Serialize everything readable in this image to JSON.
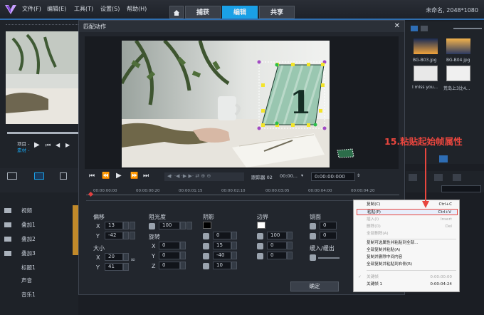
{
  "app": {
    "menu": [
      "文件(F)",
      "编辑(E)",
      "工具(T)",
      "设置(S)",
      "帮助(H)"
    ],
    "tabs": [
      "捕获",
      "编辑",
      "共享"
    ],
    "active_tab": "编辑",
    "project_name": "未命名, 2048*1080"
  },
  "left_panel": {
    "labels": [
      "项目 -",
      "素材 -"
    ]
  },
  "library": {
    "items": [
      {
        "name": "BG-B03.jpg"
      },
      {
        "name": "BG-B04.jpg"
      },
      {
        "name": "I miss you..."
      },
      {
        "name": "荒岛上3比4..."
      }
    ]
  },
  "dialog": {
    "title": "匹配动作",
    "close": "✕",
    "overlay_number": "1",
    "tracker": {
      "label": "跟踪器 02",
      "time_prefix": "00:00...",
      "timecode": "0:00:00:000"
    },
    "ruler_ticks": [
      "00:00:00:00",
      "00:00:00:20",
      "00:00:01:15",
      "00:00:02:10",
      "00:00:03:05",
      "00:00:04:00",
      "00:00:04:20"
    ],
    "offset": {
      "label": "偏移",
      "x_label": "X",
      "x": "13",
      "y_label": "Y",
      "y": "-42"
    },
    "size": {
      "label": "大小",
      "x_label": "X",
      "x": "20",
      "y_label": "Y",
      "y": "41"
    },
    "opacity": {
      "label": "阻光度",
      "value": "100"
    },
    "rotation": {
      "label": "旋转",
      "x_label": "X",
      "x": "0",
      "y_label": "Y",
      "y": "0",
      "z_label": "Z",
      "z": "0"
    },
    "shadow": {
      "label": "阴影",
      "v1": "0",
      "v2": "15",
      "v3": "-40",
      "v4": "10"
    },
    "border": {
      "label": "边界",
      "v1": "100",
      "v2": "0",
      "v3": "0"
    },
    "mirror": {
      "label": "镜面",
      "v1": "0",
      "v2": "0"
    },
    "fade": {
      "label": "缓入/缓出"
    },
    "ok_button": "确定"
  },
  "tracks": {
    "items": [
      "视频",
      "叠加1",
      "叠加2",
      "叠加3",
      "标题1",
      "声音",
      "音乐1"
    ]
  },
  "context_menu": {
    "items": [
      {
        "label": "复制(C)",
        "shortcut": "Ctrl+C",
        "disabled": false
      },
      {
        "label": "粘贴(P)",
        "shortcut": "Ctrl+V",
        "disabled": false,
        "highlighted": true
      },
      {
        "label": "插入(I)",
        "shortcut": "Insert",
        "disabled": true
      },
      {
        "label": "删除(D)",
        "shortcut": "Del",
        "disabled": true
      },
      {
        "label": "全部删除(A)",
        "shortcut": "",
        "disabled": true
      },
      {
        "label": "复制可选属性并粘贴到全部...",
        "shortcut": "",
        "disabled": false
      },
      {
        "label": "全部复制并粘贴(A)",
        "shortcut": "",
        "disabled": false
      },
      {
        "label": "复制并删除中间内容",
        "shortcut": "",
        "disabled": false
      },
      {
        "label": "全部复制并粘贴到右侧(R)",
        "shortcut": "",
        "disabled": false
      }
    ],
    "keyframes": [
      {
        "check": "✓",
        "label": "关键帧",
        "time": "0:00:00:00",
        "disabled": true
      },
      {
        "check": "",
        "label": "关键帧  1",
        "time": "0:00:04:24",
        "disabled": false
      }
    ]
  },
  "annotation": "15.粘贴起始帧属性",
  "colors": {
    "accent": "#1aa0e6",
    "highlight_border": "#e8463e",
    "annotation": "#e8463e"
  }
}
